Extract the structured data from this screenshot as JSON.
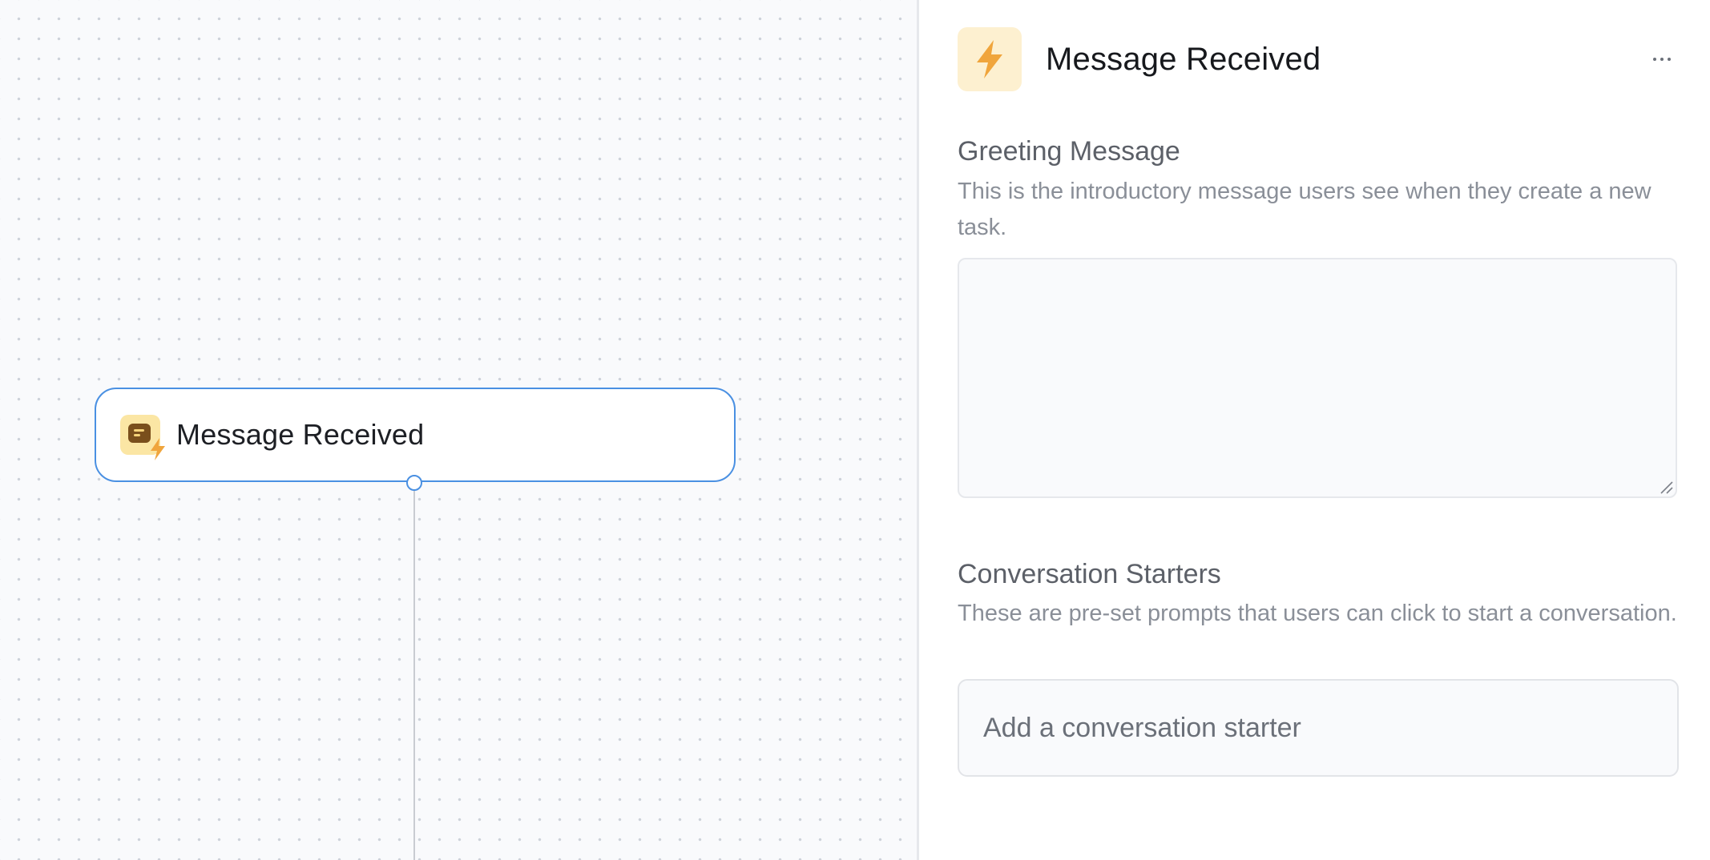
{
  "canvas": {
    "node": {
      "title": "Message Received",
      "icon": "message-trigger-icon"
    }
  },
  "panel": {
    "header": {
      "title": "Message Received",
      "icon": "lightning-bolt-icon",
      "more_icon": "more-horizontal-icon"
    },
    "greeting": {
      "title": "Greeting Message",
      "description": "This is the introductory message users see when they create a new task.",
      "value": ""
    },
    "starters": {
      "title": "Conversation Starters",
      "description": "These are pre-set prompts that users can click to start a conversation.",
      "placeholder": "Add a conversation starter"
    }
  },
  "colors": {
    "accent": "#4a90e2",
    "bolt": "#f0a53c",
    "icon_bg": "#fdf0d0"
  }
}
